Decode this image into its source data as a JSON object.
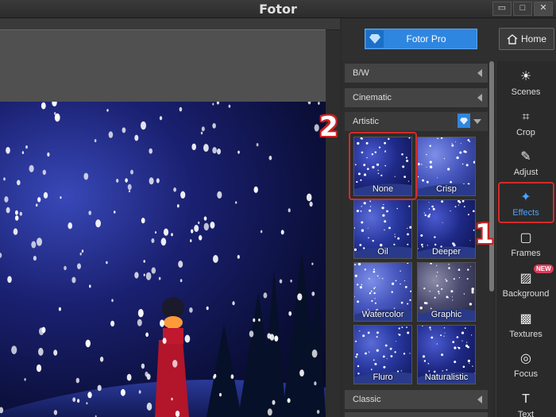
{
  "window": {
    "title": "Fotor",
    "controls": [
      "minimize-icon",
      "maximize-icon",
      "close-icon"
    ],
    "controls_glyphs": [
      "▭",
      "□",
      "✕"
    ]
  },
  "header": {
    "pro_button_label": "Fotor Pro",
    "home_button_label": "Home"
  },
  "panel": {
    "sections": [
      {
        "label": "B/W"
      },
      {
        "label": "Cinematic"
      },
      {
        "label": "Artistic"
      },
      {
        "label": "Classic"
      }
    ],
    "artistic_effects": [
      {
        "label": "None"
      },
      {
        "label": "Crisp"
      },
      {
        "label": "Oil"
      },
      {
        "label": "Deeper"
      },
      {
        "label": "Watercolor"
      },
      {
        "label": "Graphic"
      },
      {
        "label": "Fluro"
      },
      {
        "label": "Naturalistic"
      }
    ]
  },
  "tools": [
    {
      "label": "Scenes",
      "icon": "scenes-icon",
      "glyph": "☀"
    },
    {
      "label": "Crop",
      "icon": "crop-icon",
      "glyph": "⌗"
    },
    {
      "label": "Adjust",
      "icon": "adjust-icon",
      "glyph": "✎"
    },
    {
      "label": "Effects",
      "icon": "effects-icon",
      "glyph": "✦"
    },
    {
      "label": "Frames",
      "icon": "frames-icon",
      "glyph": "▢"
    },
    {
      "label": "Background",
      "icon": "background-icon",
      "glyph": "▨"
    },
    {
      "label": "Textures",
      "icon": "textures-icon",
      "glyph": "▩"
    },
    {
      "label": "Focus",
      "icon": "focus-icon",
      "glyph": "◎"
    },
    {
      "label": "Text",
      "icon": "text-icon",
      "glyph": "T"
    }
  ],
  "badges": {
    "background_new": "NEW"
  },
  "annotations": {
    "step_1": "1",
    "step_2": "2"
  },
  "colors": {
    "accent": "#2f86e0",
    "active_tool": "#4aa3ff",
    "highlight": "#d42a2a"
  }
}
